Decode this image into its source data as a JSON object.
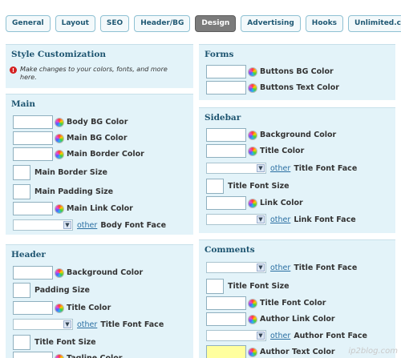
{
  "tabs": [
    "General",
    "Layout",
    "SEO",
    "Header/BG",
    "Design",
    "Advertising",
    "Hooks",
    "Unlimited.css"
  ],
  "active_tab": "Design",
  "style": {
    "title": "Style Customization",
    "note": "Make changes to your colors, fonts, and more here."
  },
  "main": {
    "title": "Main",
    "body_bg": "Body BG Color",
    "main_bg": "Main BG Color",
    "main_border": "Main Border Color",
    "border_size": "Main Border Size",
    "padding_size": "Main Padding Size",
    "link_color": "Main Link Color",
    "other": "other",
    "font_face": "Body Font Face"
  },
  "header": {
    "title": "Header",
    "bg_color": "Background Color",
    "padding": "Padding Size",
    "title_color": "Title Color",
    "other": "other",
    "title_font_face": "Title Font Face",
    "title_font_size": "Title Font Size",
    "tagline_color": "Tagline Color"
  },
  "forms": {
    "title": "Forms",
    "buttons_bg": "Buttons BG Color",
    "buttons_text": "Buttons Text Color"
  },
  "sidebar": {
    "title": "Sidebar",
    "bg_color": "Background Color",
    "title_color": "Title Color",
    "other": "other",
    "title_font_face": "Title Font Face",
    "title_font_size": "Title Font Size",
    "link_color": "Link Color",
    "link_font_face": "Link Font Face"
  },
  "comments": {
    "title": "Comments",
    "other": "other",
    "title_font_face": "Title Font Face",
    "title_font_size": "Title Font Size",
    "title_font_color": "Title Font Color",
    "author_link_color": "Author Link Color",
    "author_font_face": "Author Font Face",
    "author_text_color": "Author Text Color"
  },
  "watermark": "ip2blog.com",
  "colors": {
    "panel_bg": "#e3f3f9",
    "title": "#1d5470",
    "link": "#2a6fa2",
    "highlight_input": "#ffff9e"
  }
}
